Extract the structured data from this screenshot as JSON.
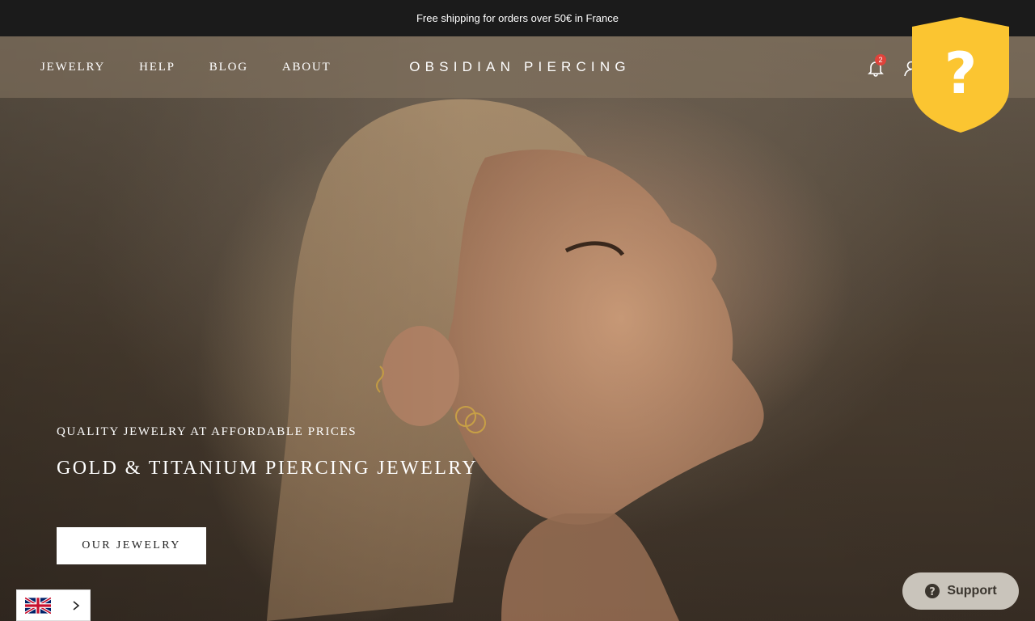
{
  "announcement": {
    "text": "Free shipping for orders over 50€ in France"
  },
  "nav": {
    "items": [
      {
        "label": "JEWELRY"
      },
      {
        "label": "HELP"
      },
      {
        "label": "BLOG"
      },
      {
        "label": "ABOUT"
      }
    ]
  },
  "brand": {
    "logo_text": "OBSIDIAN PIERCING"
  },
  "header_icons": {
    "notifications": {
      "icon": "bell-icon",
      "count": "2"
    },
    "account": {
      "icon": "user-icon"
    }
  },
  "shield": {
    "icon": "question-shield-icon",
    "color": "#fbc531"
  },
  "hero": {
    "eyebrow": "QUALITY JEWELRY AT AFFORDABLE PRICES",
    "headline": "GOLD & TITANIUM PIERCING JEWELRY",
    "cta_label": "OUR JEWELRY"
  },
  "language_selector": {
    "flag": "uk-flag-icon",
    "chevron": "chevron-right-icon"
  },
  "support": {
    "label": "Support",
    "icon": "help-circle-icon"
  },
  "colors": {
    "announcement_bg": "#1b1b1b",
    "badge": "#e0433b",
    "support_bg": "#c9c4bb"
  }
}
